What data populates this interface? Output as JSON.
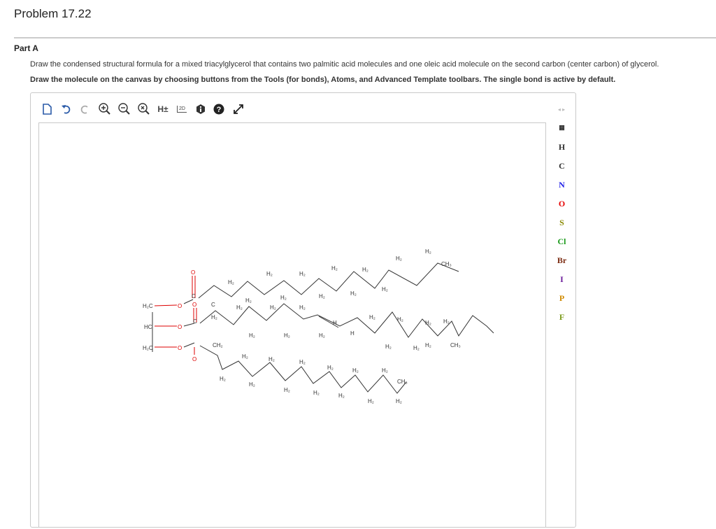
{
  "header": {
    "title": "Problem 17.22"
  },
  "part": {
    "label": "Part A",
    "instruction": "Draw the condensed structural formula for a mixed triacylglycerol that contains two palmitic acid molecules and one oleic acid molecule on the second carbon (center carbon) of glycerol.",
    "instruction_bold": "Draw the molecule on the canvas by choosing buttons from the Tools (for bonds), Atoms, and Advanced Template toolbars. The single bond is active by default."
  },
  "toolbar": {
    "h_toggle_label": "H±",
    "twod_label": "2D",
    "icons": [
      "new-document-icon",
      "undo-icon",
      "redo-icon",
      "zoom-in-icon",
      "zoom-out-icon",
      "zoom-reset-icon",
      "explicit-hydrogens-icon",
      "clean-2d-icon",
      "info-icon",
      "help-icon",
      "expand-icon"
    ]
  },
  "left_tools": {
    "plus_label": "+",
    "minus_label": "-"
  },
  "atoms": [
    "H",
    "C",
    "N",
    "O",
    "S",
    "Cl",
    "Br",
    "I",
    "P",
    "F"
  ],
  "atom_colors": {
    "H": "#333333",
    "C": "#333333",
    "N": "#1a1ae6",
    "O": "#e60000",
    "S": "#8a8a00",
    "Cl": "#1a9a1a",
    "Br": "#7a2a10",
    "I": "#6a1a9a",
    "P": "#d08a00",
    "F": "#7a9a1a"
  },
  "molecule": {
    "glycerol": [
      "H₂C",
      "HC",
      "H₂C"
    ],
    "ester_oxygen": "O",
    "carbonyl_oxygen": "O",
    "ch2": "H₂",
    "c": "C",
    "ch": "H",
    "ch2_group": "CH₂",
    "ch3": "CH₃"
  }
}
